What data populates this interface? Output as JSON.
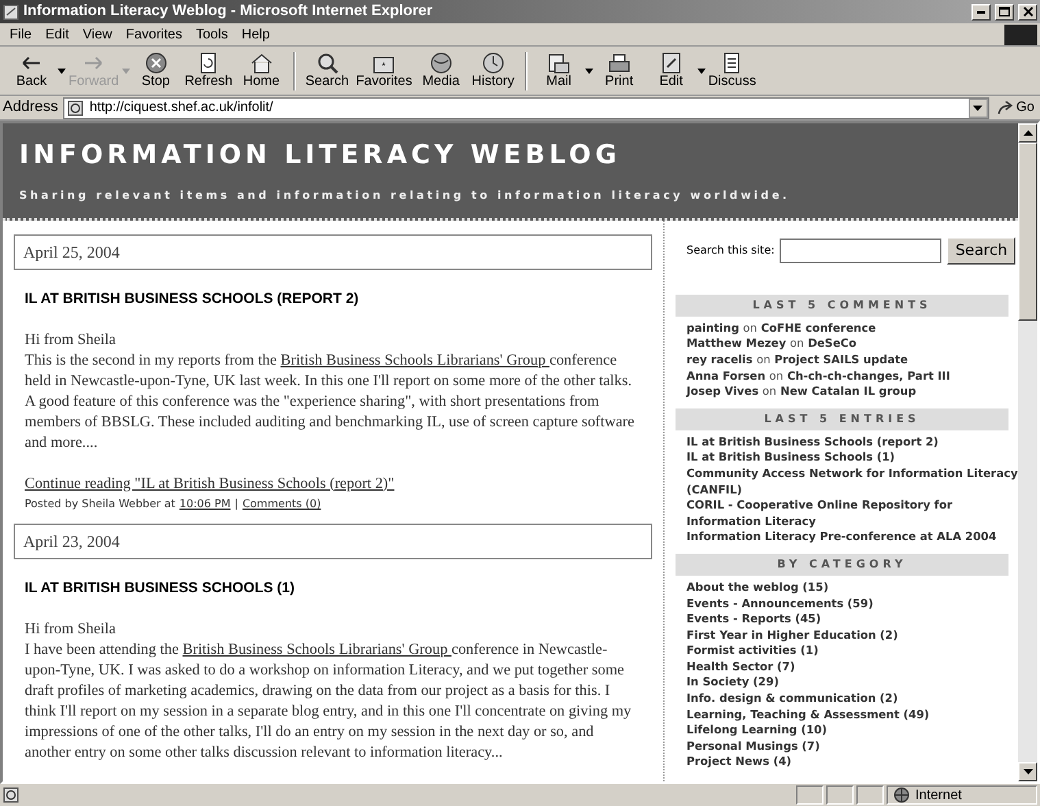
{
  "window": {
    "title": "Information Literacy Weblog - Microsoft Internet Explorer"
  },
  "menu": [
    "File",
    "Edit",
    "View",
    "Favorites",
    "Tools",
    "Help"
  ],
  "toolbar": [
    {
      "label": "Back",
      "disabled": false,
      "dropdown": true
    },
    {
      "label": "Forward",
      "disabled": true,
      "dropdown": true
    },
    {
      "label": "Stop",
      "disabled": false,
      "dropdown": false
    },
    {
      "label": "Refresh",
      "disabled": false,
      "dropdown": false
    },
    {
      "label": "Home",
      "disabled": false,
      "dropdown": false
    },
    {
      "label": "Search",
      "disabled": false,
      "dropdown": false
    },
    {
      "label": "Favorites",
      "disabled": false,
      "dropdown": false
    },
    {
      "label": "Media",
      "disabled": false,
      "dropdown": false
    },
    {
      "label": "History",
      "disabled": false,
      "dropdown": false
    },
    {
      "label": "Mail",
      "disabled": false,
      "dropdown": true
    },
    {
      "label": "Print",
      "disabled": false,
      "dropdown": false
    },
    {
      "label": "Edit",
      "disabled": false,
      "dropdown": true
    },
    {
      "label": "Discuss",
      "disabled": false,
      "dropdown": false
    }
  ],
  "address": {
    "label": "Address",
    "url": "http://ciquest.shef.ac.uk/infolit/",
    "go": "Go"
  },
  "blog": {
    "title": "INFORMATION LITERACY WEBLOG",
    "tagline": "Sharing relevant items and information relating to information literacy worldwide."
  },
  "posts": [
    {
      "date": "April 25, 2004",
      "title": "IL AT BRITISH BUSINESS SCHOOLS (REPORT 2)",
      "greeting": "Hi from Sheila",
      "body_before": "This is the second in my reports from the ",
      "body_link": "British Business Schools Librarians' Group ",
      "body_after": "conference held in Newcastle-upon-Tyne, UK last week. In this one I'll report on some more of the other talks. A good feature of this conference was the \"experience sharing\", with short presentations from members of BBSLG. These included auditing and benchmarking IL, use of screen capture software and more....",
      "continue": "Continue reading \"IL at British Business Schools (report 2)\"",
      "posted_by": "Posted by Sheila Webber at",
      "time": "10:06 PM",
      "separator": "|",
      "comments": "Comments (0)"
    },
    {
      "date": "April 23, 2004",
      "title": "IL AT BRITISH BUSINESS SCHOOLS (1)",
      "greeting": "Hi from Sheila",
      "body_before": "I have been attending the ",
      "body_link": "British Business Schools Librarians' Group ",
      "body_after": "conference in Newcastle-upon-Tyne, UK. I was asked to do a workshop on information Literacy, and we put together some draft profiles of marketing academics, drawing on the data from our project as a basis for this. I think I'll report on my session in a separate blog entry, and in this one I'll concentrate on giving my impressions of one of the other talks, I'll do an entry on my session in the next day or so, and another entry on some other talks discussion relevant to information literacy..."
    }
  ],
  "sidebar": {
    "search_label": "Search this site:",
    "search_button": "Search",
    "comments_heading": "LAST 5 COMMENTS",
    "comments": [
      {
        "author": "painting",
        "on": "on",
        "post": "CoFHE conference"
      },
      {
        "author": "Matthew Mezey",
        "on": "on",
        "post": "DeSeCo"
      },
      {
        "author": "rey racelis",
        "on": "on",
        "post": "Project SAILS update"
      },
      {
        "author": "Anna Forsen",
        "on": "on",
        "post": "Ch-ch-ch-changes, Part III"
      },
      {
        "author": "Josep Vives",
        "on": "on",
        "post": "New Catalan IL group"
      }
    ],
    "entries_heading": "LAST 5 ENTRIES",
    "entries": [
      "IL at British Business Schools (report 2)",
      "IL at British Business Schools (1)",
      "Community Access Network for Information Literacy (CANFIL)",
      "CORIL - Cooperative Online Repository for Information Literacy",
      "Information Literacy Pre-conference at ALA 2004"
    ],
    "category_heading": "BY CATEGORY",
    "categories": [
      "About the weblog (15)",
      "Events - Announcements (59)",
      "Events - Reports (45)",
      "First Year in Higher Education (2)",
      "Formist activities (1)",
      "Health Sector (7)",
      "In Society (29)",
      "Info. design & communication (2)",
      "Learning, Teaching & Assessment (49)",
      "Lifelong Learning (10)",
      "Personal Musings (7)",
      "Project News (4)"
    ]
  },
  "status_bar": {
    "zone": "Internet"
  }
}
